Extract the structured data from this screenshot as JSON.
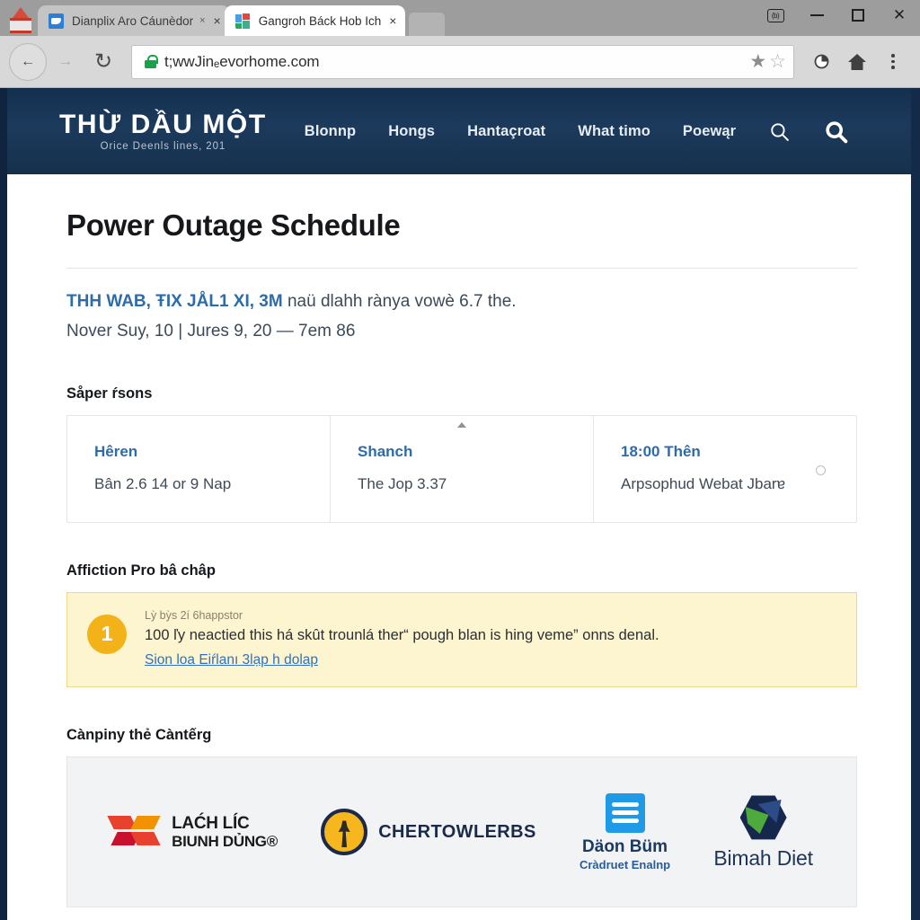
{
  "browser": {
    "tabs": [
      {
        "title": "Dianplix Aro Cáunèdor",
        "mute": "×",
        "close": "×",
        "favicon": "document-favicon"
      },
      {
        "title": "Gangroh Báck Hob Ich",
        "mute": "",
        "close": "×",
        "favicon": "colored-squares-favicon"
      }
    ],
    "window_controls": {
      "badge": "(b)",
      "minimize": "—",
      "maximize": "□",
      "close": "✕"
    },
    "toolbar": {
      "back": "←",
      "forward": "→",
      "reload": "↻",
      "url": "t;wwJinₑevorhome.com",
      "lock": "secure-lock-icon",
      "star_filled": "★",
      "star_hollow": "☆",
      "extension": "◔",
      "home": "⌂",
      "menu": "⋮"
    }
  },
  "site": {
    "brand": {
      "name": "THỪ DẦU MỘT",
      "subtitle": "Orice Deenls lines, 201"
    },
    "nav": [
      {
        "label": "Blonnp"
      },
      {
        "label": "Hongs"
      },
      {
        "label": "Hantaçroat"
      },
      {
        "label": "What timo"
      },
      {
        "label": "Poewąr"
      }
    ],
    "nav_search_small": "search-icon",
    "nav_search_large": "search-icon"
  },
  "main": {
    "page_title": "Power Outage Schedule",
    "lede_strong": "THH WAB, ŦIX JÅL1 XІ, 3M",
    "lede_rest": " naü dlahh rànya vowè 6.7 the.",
    "lede_line2": "Nover Suy, 10 | Jures 9, 20 — 7em 86",
    "schedule_heading": "Såper ŕsons",
    "cards": [
      {
        "title": "Hêren",
        "body": "Bân 2.6 14 or 9 Nap"
      },
      {
        "title": "Shanch",
        "body": "The Jop 3.37"
      },
      {
        "title": "18:00 Thên",
        "body": "Arpsophud Webat Jbarɐ"
      }
    ],
    "alert_heading": "Affiction Pro bâ châp",
    "alert": {
      "badge": "1",
      "kicker": "Lỳ bỳs 2í 6happstor",
      "text": "100 ľy neactied this há skût trounlá ther“ pough blan is hing veme” onns denal.",
      "link": "Sion loa Eiŕlanı 3lạp h dolap"
    },
    "partners_heading": "Cànpiny thẻ Càntếrg",
    "partners": [
      {
        "icon": "x-mark-logo-icon",
        "line1": "LAĆH LÍC",
        "line2": "BƖUNH DỦNG®"
      },
      {
        "icon": "circular-seal-logo-icon",
        "line1": "CHERTOWLERBS",
        "line2": ""
      },
      {
        "icon": "blue-square-logo-icon",
        "line1": "Däon Büm",
        "line2": "Cràdruet Enalnp"
      },
      {
        "icon": "hexagon-logo-icon",
        "line1": "Bimah Diet",
        "line2": ""
      }
    ]
  },
  "colors": {
    "header_navy": "#16304c",
    "link_blue": "#2d6ca8",
    "alert_bg": "#fdf4d0",
    "alert_badge": "#f3b318"
  }
}
